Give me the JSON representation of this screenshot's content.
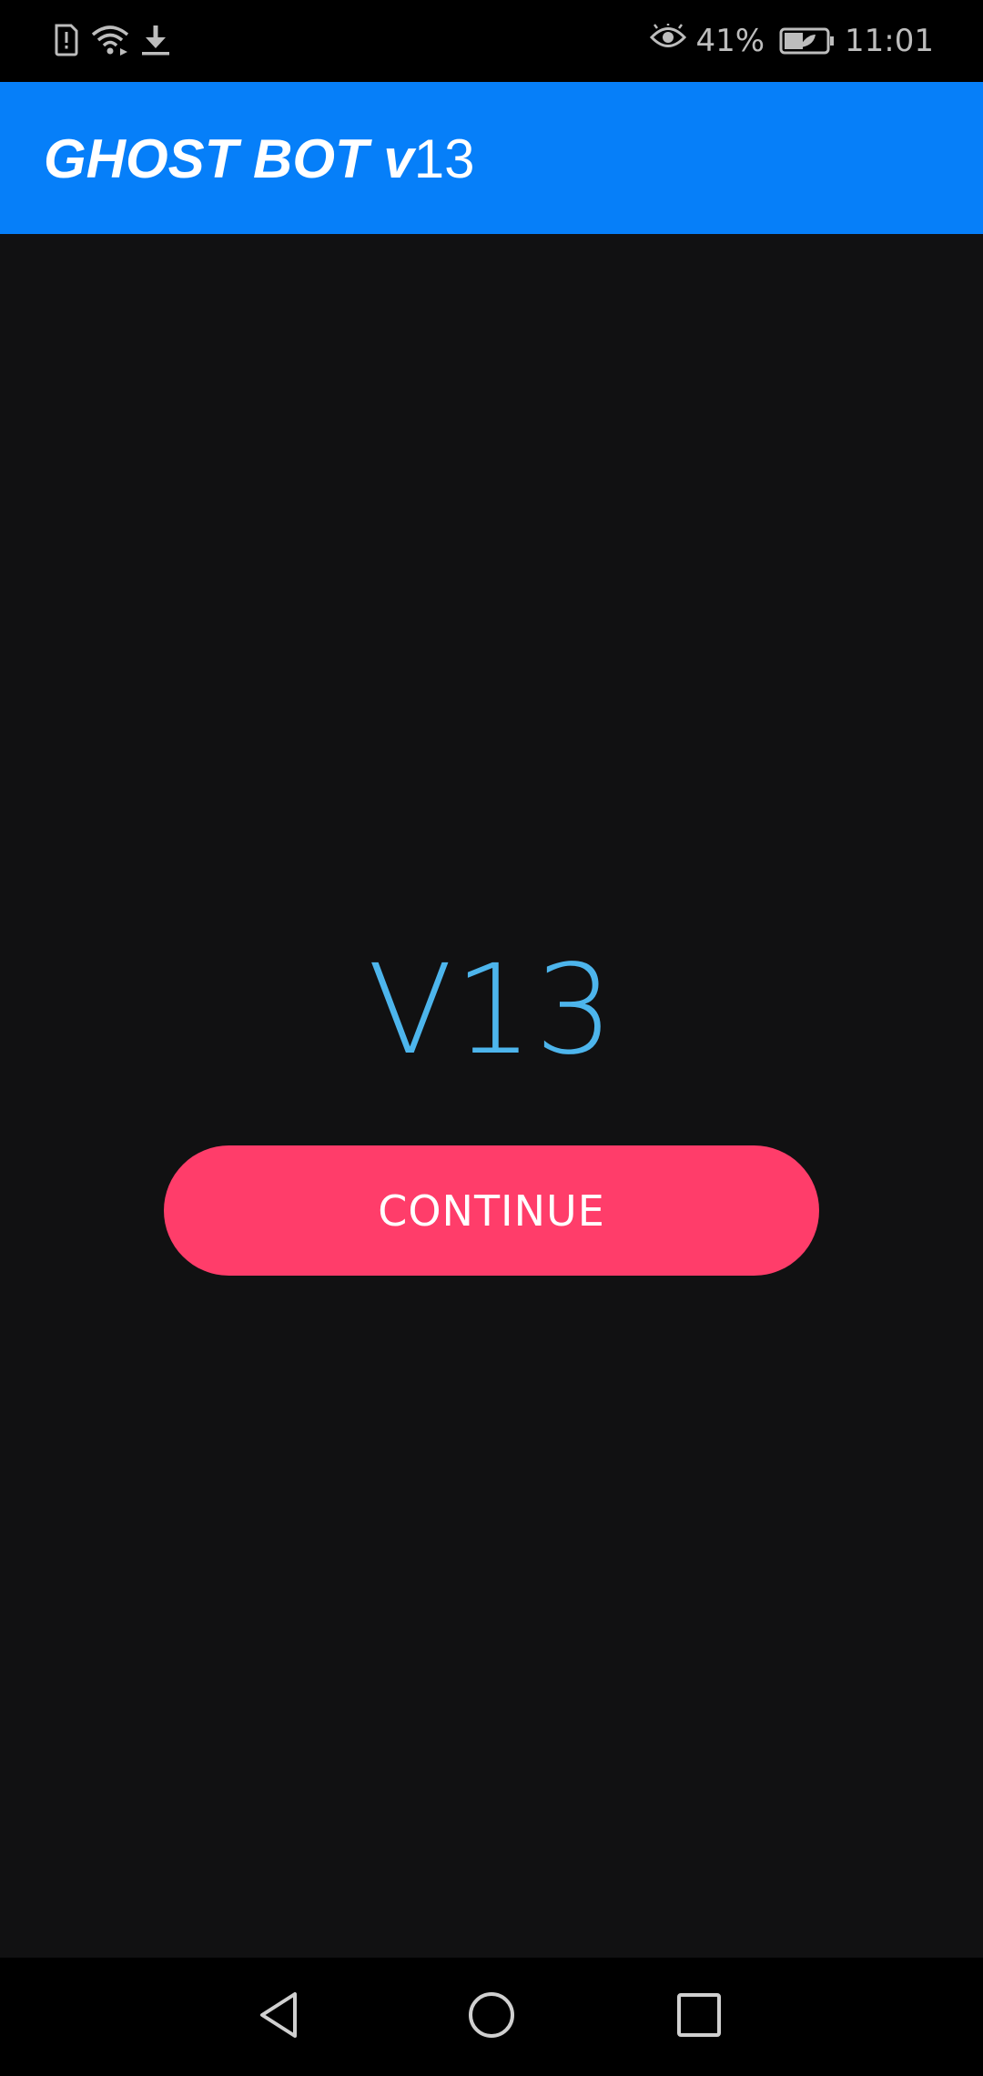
{
  "status_bar": {
    "icons_left": [
      "sim-alert-icon",
      "wifi-icon",
      "download-icon"
    ],
    "icons_right": [
      "eye-icon",
      "battery-icon"
    ],
    "battery_percent": "41%",
    "time": "11:01"
  },
  "app_bar": {
    "title_bold": "GHOST BOT v",
    "title_version": "13",
    "color": "#067ff9"
  },
  "main": {
    "version_label": "V13",
    "version_color": "#4db5ec",
    "continue_label": "CONTINUE",
    "button_color": "#ff3d6a",
    "background": "#111112"
  },
  "nav_bar": {
    "icons": [
      "back-icon",
      "home-icon",
      "recent-apps-icon"
    ]
  }
}
